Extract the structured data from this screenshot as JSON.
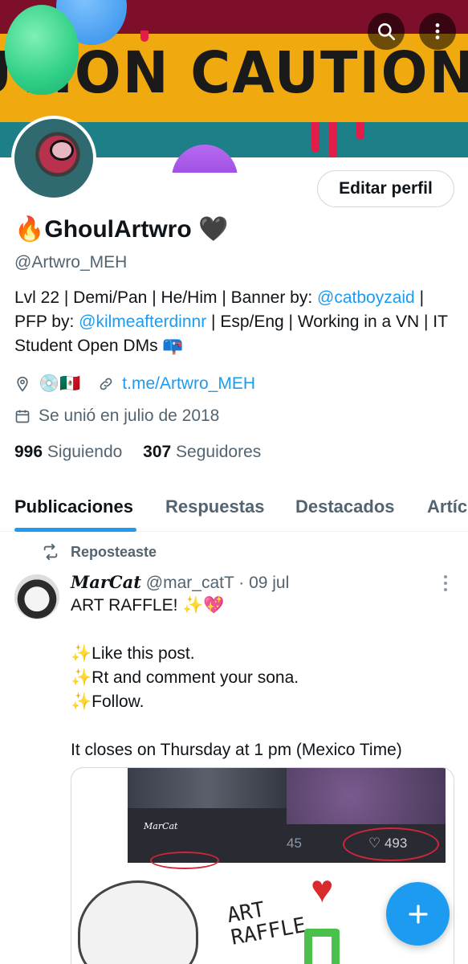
{
  "banner": {
    "text": "UTION  CAUTION  CAUTI"
  },
  "header_actions": {
    "search_icon": "search-icon",
    "more_icon": "more-vertical-icon"
  },
  "profile": {
    "display_name": "🔥GhoulArtwro 🖤",
    "handle": "@Artwro_MEH",
    "edit_button": "Editar perfil",
    "bio": {
      "part1": "Lvl 22 | Demi/Pan | He/Him | Banner by: ",
      "mention1": "@catboyzaid",
      "part2": " | PFP by: ",
      "mention2": "@kilmeafterdinnr",
      "part3": " | Esp/Eng | Working in a VN | IT Student  Open DMs 📪"
    },
    "location": "💿🇲🇽",
    "website": "t.me/Artwro_MEH",
    "joined": "Se unió en julio de 2018",
    "following_count": "996",
    "following_label": "Siguiendo",
    "followers_count": "307",
    "followers_label": "Seguidores"
  },
  "tabs": [
    {
      "label": "Publicaciones",
      "active": true
    },
    {
      "label": "Respuestas",
      "active": false
    },
    {
      "label": "Destacados",
      "active": false
    },
    {
      "label": "Artíc",
      "active": false
    }
  ],
  "post": {
    "repost_label": "Reposteaste",
    "author_name": "MarCat",
    "author_handle": "@mar_catT",
    "separator": " · ",
    "date": "09 jul",
    "text": "ART RAFFLE! ✨💖\n\n✨Like this post.\n✨Rt and comment your sona.\n✨Follow.\n\nIt closes on Thursday at 1 pm (Mexico Time)",
    "media": {
      "name": "MarCat",
      "reply_count": "45",
      "like_count": "♡ 493",
      "raffle_text": "ART\nRAFFLE"
    }
  },
  "fab": {
    "icon": "plus-icon"
  },
  "colors": {
    "accent": "#1d9bf0",
    "text": "#0f1419",
    "secondary": "#536471"
  }
}
